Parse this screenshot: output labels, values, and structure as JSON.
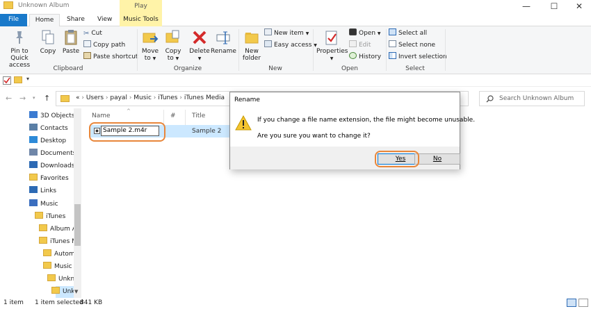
{
  "window": {
    "title": "Unknown Album",
    "context_tab_header": "Play",
    "minimize_glyph": "—",
    "maximize_glyph": "☐",
    "close_glyph": "✕"
  },
  "tabs": {
    "file": "File",
    "home": "Home",
    "share": "Share",
    "view": "View",
    "music_tools": "Music Tools"
  },
  "ribbon": {
    "clipboard": {
      "pin_line1": "Pin to Quick",
      "pin_line2": "access",
      "copy": "Copy",
      "paste": "Paste",
      "cut": "Cut",
      "copy_path": "Copy path",
      "paste_shortcut": "Paste shortcut",
      "label": "Clipboard"
    },
    "organize": {
      "move_to_line1": "Move",
      "move_to_line2": "to",
      "copy_to_line1": "Copy",
      "copy_to_line2": "to",
      "delete": "Delete",
      "rename": "Rename",
      "label": "Organize"
    },
    "new": {
      "new_folder_line1": "New",
      "new_folder_line2": "folder",
      "new_item": "New item",
      "easy_access": "Easy access",
      "label": "New"
    },
    "open": {
      "properties": "Properties",
      "open": "Open",
      "edit": "Edit",
      "history": "History",
      "label": "Open"
    },
    "select": {
      "select_all": "Select all",
      "select_none": "Select none",
      "invert_selection": "Invert selection",
      "label": "Select"
    }
  },
  "address": {
    "crumbs": [
      "«",
      "Users",
      "payal",
      "Music",
      "iTunes",
      "iTunes Media"
    ],
    "search_placeholder": "Search Unknown Album"
  },
  "nav_pane": {
    "items": [
      {
        "label": "3D Objects",
        "icon": "3d-objects-icon"
      },
      {
        "label": "Contacts",
        "icon": "contacts-icon"
      },
      {
        "label": "Desktop",
        "icon": "desktop-icon"
      },
      {
        "label": "Documents",
        "icon": "documents-icon"
      },
      {
        "label": "Downloads",
        "icon": "downloads-icon"
      },
      {
        "label": "Favorites",
        "icon": "favorites-icon"
      },
      {
        "label": "Links",
        "icon": "links-icon"
      },
      {
        "label": "Music",
        "icon": "music-icon"
      },
      {
        "label": "iTunes",
        "icon": "folder-icon"
      },
      {
        "label": "Album A",
        "icon": "folder-icon"
      },
      {
        "label": "iTunes M",
        "icon": "folder-icon"
      },
      {
        "label": "Autom",
        "icon": "folder-icon"
      },
      {
        "label": "Music",
        "icon": "folder-icon"
      },
      {
        "label": "Unkno",
        "icon": "folder-icon"
      },
      {
        "label": "Unk",
        "icon": "folder-icon"
      }
    ]
  },
  "file_list": {
    "columns": [
      "Name",
      "#",
      "Title"
    ],
    "rows": [
      {
        "name_editing": "Sample 2.m4r",
        "title": "Sample 2"
      }
    ]
  },
  "status": {
    "item_count": "1 item",
    "selection": "1 item selected",
    "size": "841 KB"
  },
  "dialog": {
    "title": "Rename",
    "message_line1": "If you change a file name extension, the file might become unusable.",
    "message_line2": "Are you sure you want to change it?",
    "yes": "Yes",
    "no": "No"
  },
  "colors": {
    "accent": "#1979ca",
    "selection": "#cce8ff",
    "highlight_ring": "#e8863a",
    "music_tools": "#fff3a8"
  }
}
